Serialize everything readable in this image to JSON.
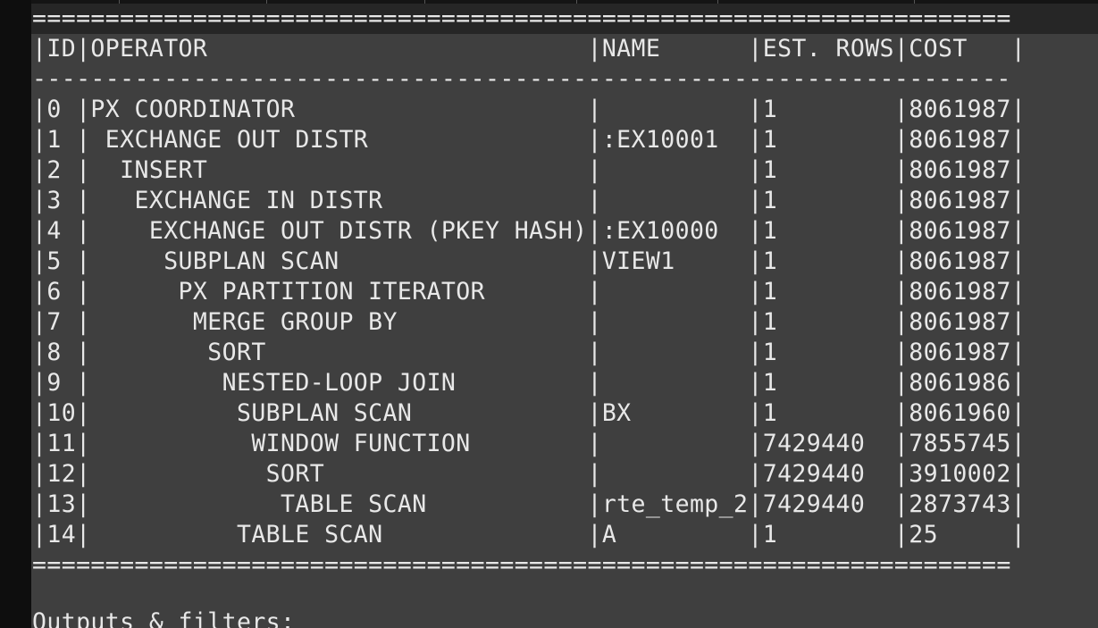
{
  "plan": {
    "border_top": "===================================================================",
    "header": "|ID|OPERATOR                          |NAME      |EST. ROWS|COST   |",
    "divider": "-------------------------------------------------------------------",
    "rows": [
      "|0 |PX COORDINATOR                    |          |1        |8061987|",
      "|1 | EXCHANGE OUT DISTR               |:EX10001  |1        |8061987|",
      "|2 |  INSERT                          |          |1        |8061987|",
      "|3 |   EXCHANGE IN DISTR              |          |1        |8061987|",
      "|4 |    EXCHANGE OUT DISTR (PKEY HASH)|:EX10000  |1        |8061987|",
      "|5 |     SUBPLAN SCAN                 |VIEW1     |1        |8061987|",
      "|6 |      PX PARTITION ITERATOR       |          |1        |8061987|",
      "|7 |       MERGE GROUP BY             |          |1        |8061987|",
      "|8 |        SORT                      |          |1        |8061987|",
      "|9 |         NESTED-LOOP JOIN         |          |1        |8061986|",
      "|10|          SUBPLAN SCAN            |BX        |1        |8061960|",
      "|11|           WINDOW FUNCTION        |          |7429440  |7855745|",
      "|12|            SORT                  |          |7429440  |3910002|",
      "|13|             TABLE SCAN           |rte_temp_2|7429440  |2873743|",
      "|14|          TABLE SCAN              |A         |1        |25     |"
    ],
    "border_bottom": "===================================================================",
    "footer": "Outputs & filters:"
  }
}
